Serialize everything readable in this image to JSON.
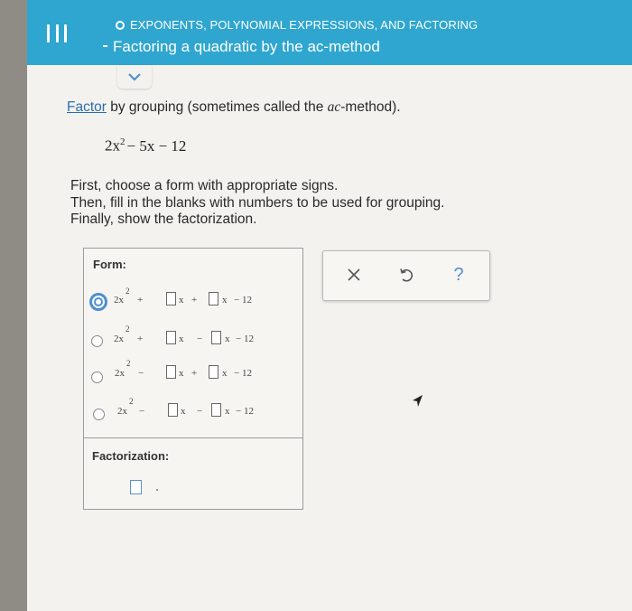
{
  "header": {
    "topic": "EXPONENTS, POLYNOMIAL EXPRESSIONS, AND FACTORING",
    "title": "Factoring a quadratic by the ac-method"
  },
  "instructions": {
    "link": "Factor",
    "text_before_ac": " by grouping (sometimes called the ",
    "ac": "ac",
    "text_after_ac": "-method).",
    "steps": [
      "First, choose a form with appropriate signs.",
      "Then, fill in the blanks with numbers to be used for grouping.",
      "Finally, show the factorization."
    ]
  },
  "expression": {
    "coef": "2x",
    "exp": "2",
    "rest": "− 5x − 12"
  },
  "panel": {
    "form_label": "Form:",
    "factorization_label": "Factorization:",
    "selected_index": 0,
    "forms": [
      {
        "lead": "2x",
        "exp": "2",
        "op1": "+",
        "op2": "+",
        "var": "x",
        "tail": "−  12"
      },
      {
        "lead": "2x",
        "exp": "2",
        "op1": "+",
        "op2": "−",
        "var": "x",
        "tail": "−  12"
      },
      {
        "lead": "2x",
        "exp": "2",
        "op1": "−",
        "op2": "+",
        "var": "x",
        "tail": "−  12"
      },
      {
        "lead": "2x",
        "exp": "2",
        "op1": "−",
        "op2": "−",
        "var": "x",
        "tail": "−  12"
      }
    ]
  },
  "tools": {
    "clear_icon": "x-icon",
    "undo_icon": "undo-icon",
    "help_glyph": "?"
  },
  "colors": {
    "header": "#2fa6cf",
    "accent": "#4f8fd0",
    "link": "#2a6fb0"
  }
}
